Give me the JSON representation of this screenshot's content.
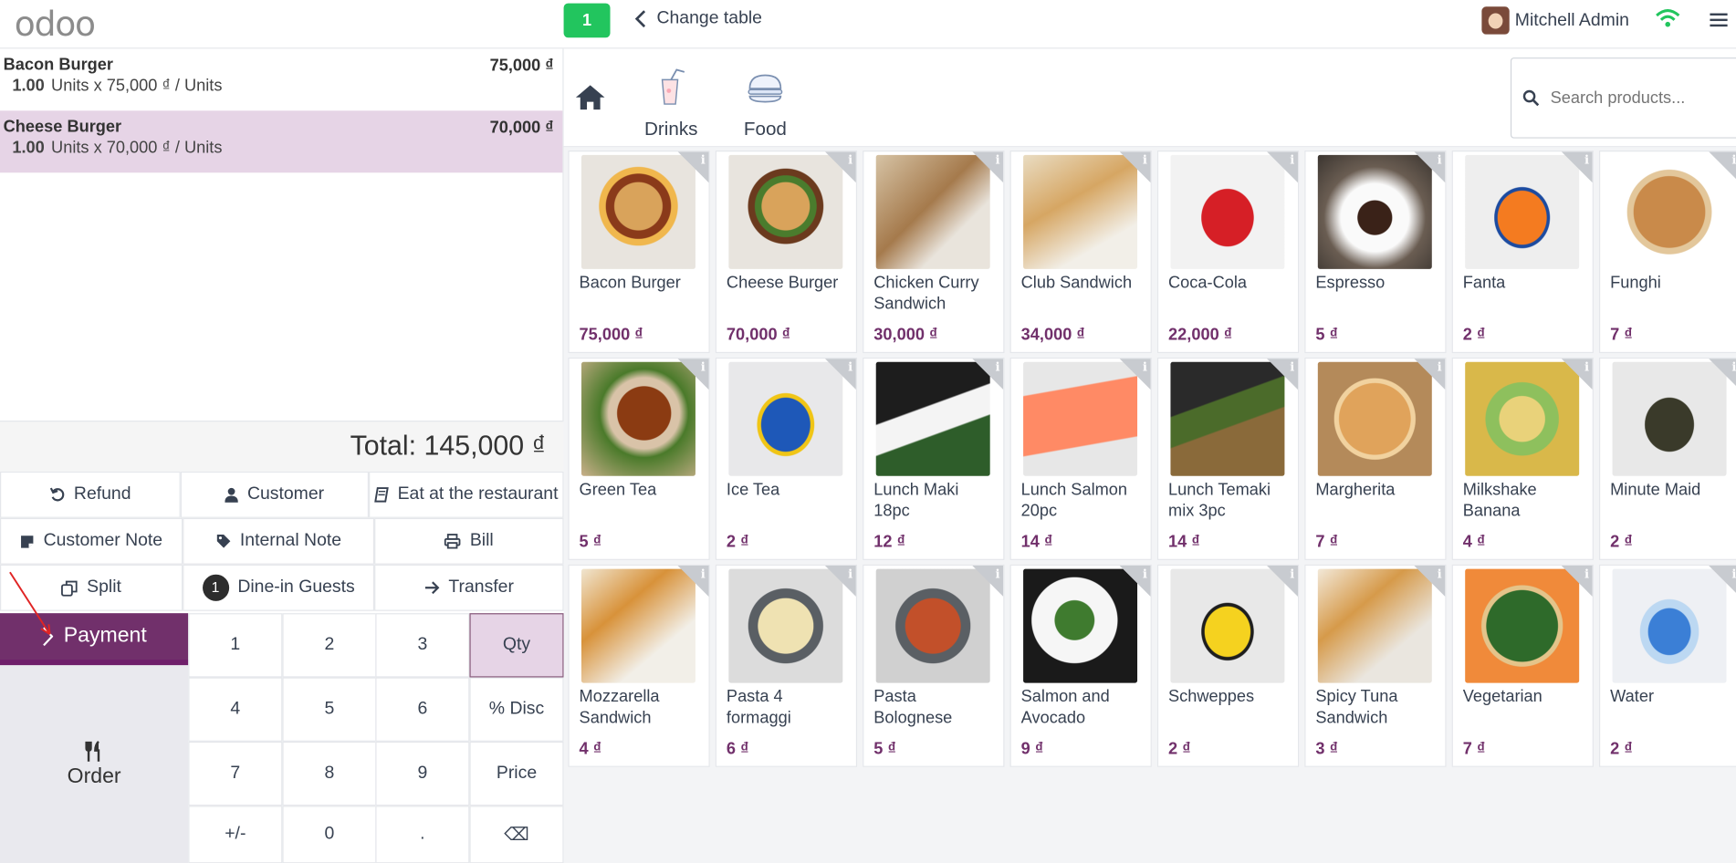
{
  "header": {
    "logo": "odoo",
    "table_number": "1",
    "change_table": "Change table",
    "user_name": "Mitchell Admin"
  },
  "order_lines": [
    {
      "name": "Bacon Burger",
      "price": "75,000 ₫",
      "qty": "1.00",
      "detail": "Units x 75,000 ₫ / Units",
      "selected": false
    },
    {
      "name": "Cheese Burger",
      "price": "70,000 ₫",
      "qty": "1.00",
      "detail": "Units x 70,000 ₫ / Units",
      "selected": true
    }
  ],
  "total": "Total: 145,000 ₫",
  "actions": {
    "refund": "Refund",
    "customer": "Customer",
    "eat_in": "Eat at the restaurant",
    "customer_note": "Customer Note",
    "internal_note": "Internal Note",
    "bill": "Bill",
    "split": "Split",
    "guests_count": "1",
    "guests": "Dine-in Guests",
    "transfer": "Transfer"
  },
  "payment": "Payment",
  "order_button": "Order",
  "numpad": [
    [
      "1",
      "2",
      "3",
      "Qty"
    ],
    [
      "4",
      "5",
      "6",
      "% Disc"
    ],
    [
      "7",
      "8",
      "9",
      "Price"
    ],
    [
      "+/-",
      "0",
      ".",
      "⌫"
    ]
  ],
  "numpad_active": "Qty",
  "categories": [
    "Drinks",
    "Food"
  ],
  "search": {
    "placeholder": "Search products..."
  },
  "products": [
    {
      "name": "Bacon Burger",
      "price": "75,000 ₫"
    },
    {
      "name": "Cheese Burger",
      "price": "70,000 ₫"
    },
    {
      "name": "Chicken Curry Sandwich",
      "price": "30,000 ₫"
    },
    {
      "name": "Club Sandwich",
      "price": "34,000 ₫"
    },
    {
      "name": "Coca-Cola",
      "price": "22,000 ₫"
    },
    {
      "name": "Espresso",
      "price": "5 ₫"
    },
    {
      "name": "Fanta",
      "price": "2 ₫"
    },
    {
      "name": "Funghi",
      "price": "7 ₫"
    },
    {
      "name": "Green Tea",
      "price": "5 ₫"
    },
    {
      "name": "Ice Tea",
      "price": "2 ₫"
    },
    {
      "name": "Lunch Maki 18pc",
      "price": "12 ₫"
    },
    {
      "name": "Lunch Salmon 20pc",
      "price": "14 ₫"
    },
    {
      "name": "Lunch Temaki mix 3pc",
      "price": "14 ₫"
    },
    {
      "name": "Margherita",
      "price": "7 ₫"
    },
    {
      "name": "Milkshake Banana",
      "price": "4 ₫"
    },
    {
      "name": "Minute Maid",
      "price": "2 ₫"
    },
    {
      "name": "Mozzarella Sandwich",
      "price": "4 ₫"
    },
    {
      "name": "Pasta 4 formaggi",
      "price": "6 ₫"
    },
    {
      "name": "Pasta Bolognese",
      "price": "5 ₫"
    },
    {
      "name": "Salmon and Avocado",
      "price": "9 ₫"
    },
    {
      "name": "Schweppes",
      "price": "2 ₫"
    },
    {
      "name": "Spicy Tuna Sandwich",
      "price": "3 ₫"
    },
    {
      "name": "Vegetarian",
      "price": "7 ₫"
    },
    {
      "name": "Water",
      "price": "2 ₫"
    }
  ],
  "colors": {
    "brand": "#71306b",
    "selected_row": "#e6d4e6",
    "table_badge": "#22c55e",
    "price": "#71306b"
  }
}
